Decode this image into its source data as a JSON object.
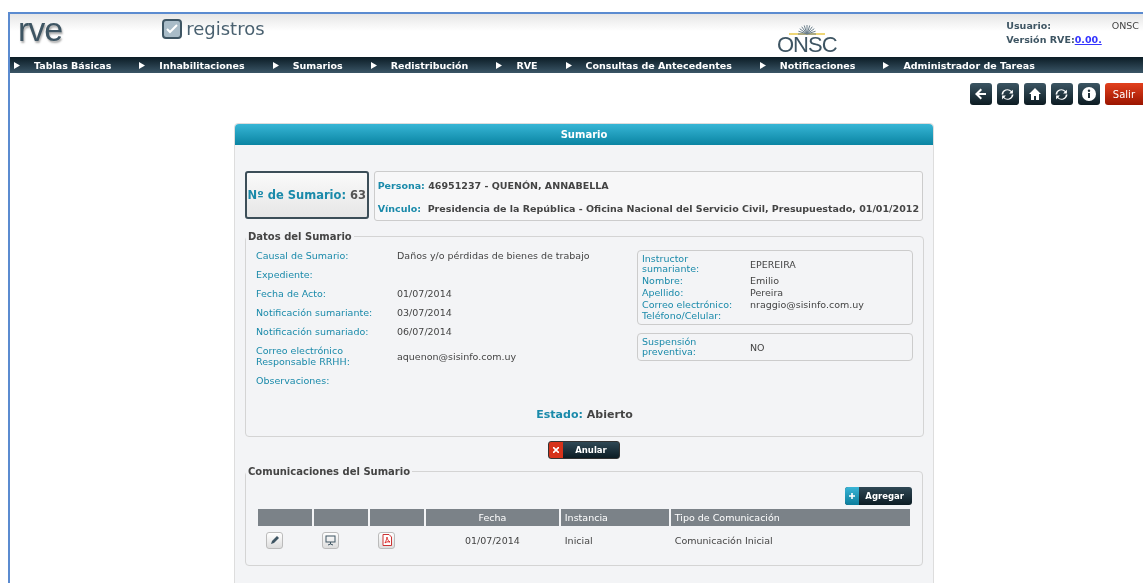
{
  "header": {
    "logo": "rve",
    "app_name": "registros",
    "org_logo": "ONSC",
    "user_label": "Usuario:",
    "user_value": "ONSC",
    "version_label": "Versión RVE:",
    "version_value": "0.00."
  },
  "menu": [
    "Tablas Básicas",
    "Inhabilitaciones",
    "Sumarios",
    "Redistribución",
    "RVE",
    "Consultas de Antecedentes",
    "Notificaciones",
    "Administrador de Tareas"
  ],
  "toolbar": [
    {
      "kind": "back"
    },
    {
      "kind": "refresh"
    },
    {
      "kind": "home"
    },
    {
      "kind": "refresh"
    },
    {
      "kind": "info"
    },
    {
      "kind": "exit",
      "label": "Salir"
    }
  ],
  "panel": {
    "title": "Sumario",
    "number_label": "Nº de Sumario:",
    "number": "63",
    "person_label": "Persona:",
    "person": "46951237 - QUENÓN, ANNABELLA",
    "link_label": "Vínculo:",
    "link": "Presidencia de la República - Oficina Nacional del Servicio Civil, Presupuestado, 01/01/2012",
    "datos": {
      "legend": "Datos del Sumario",
      "fields": [
        {
          "label": "Causal de Sumario:",
          "value": "Daños y/o pérdidas de bienes de trabajo"
        },
        {
          "label": "Expediente:"
        },
        {
          "label": "Fecha de Acto:",
          "value": "01/07/2014"
        },
        {
          "label": "Notificación sumariante:",
          "value": "03/07/2014"
        },
        {
          "label": "Notificación sumariado:",
          "value": "06/07/2014"
        },
        {
          "label": "Correo electrónico Responsable RRHH:",
          "value": "aquenon@sisinfo.com.uy"
        },
        {
          "label": "Observaciones:"
        }
      ],
      "instructor": [
        {
          "label": "Instructor sumariante:",
          "value": "EPEREIRA"
        },
        {
          "label": "Nombre:",
          "value": "Emilio"
        },
        {
          "label": "Apellido:",
          "value": "Pereira"
        },
        {
          "label": "Correo electrónico:",
          "value": "nraggio@sisinfo.com.uy"
        },
        {
          "label": "Teléfono/Celular:"
        }
      ],
      "suspension": [
        {
          "label": "Suspensión preventiva:",
          "value": "NO"
        }
      ],
      "status_label": "Estado:",
      "status": "Abierto"
    },
    "cancel_button": "Anular",
    "communications": {
      "legend": "Comunicaciones del Sumario",
      "add_button": "Agregar",
      "columns": [
        "Fecha",
        "Instancia",
        "Tipo de Comunicación"
      ],
      "rows": [
        {
          "date": "01/07/2014",
          "instance": "Inicial",
          "type": "Comunicación Inicial"
        }
      ]
    }
  }
}
